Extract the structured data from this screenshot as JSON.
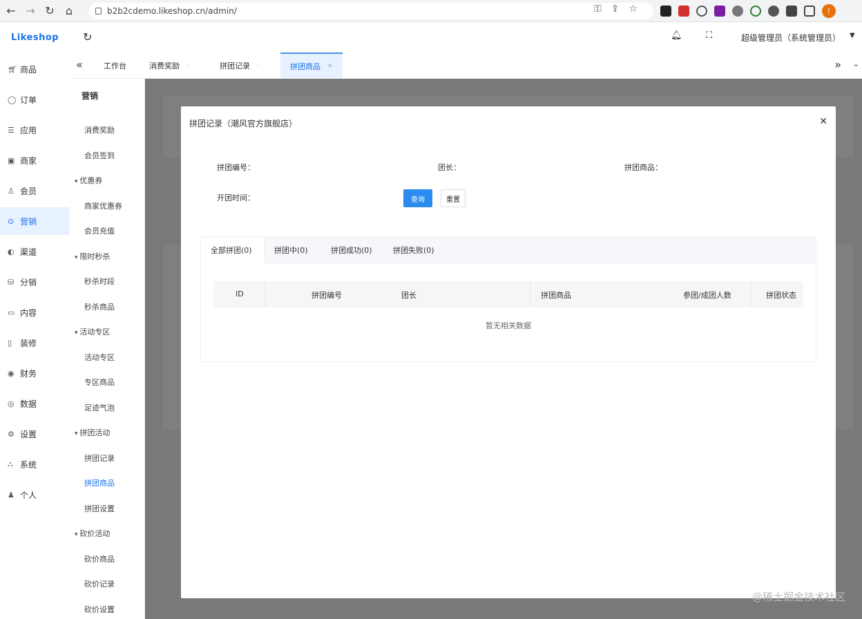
{
  "browser": {
    "url": "b2b2cdemo.likeshop.cn/admin/",
    "profile_initial": "!"
  },
  "header": {
    "logo": "Likeshop",
    "admin_label": "超级管理员（系统管理员）"
  },
  "sidebar1": {
    "items": [
      {
        "icon": "cart-icon",
        "label": "商品"
      },
      {
        "icon": "order-icon",
        "label": "订单"
      },
      {
        "icon": "app-icon",
        "label": "应用"
      },
      {
        "icon": "shop-icon",
        "label": "商家"
      },
      {
        "icon": "member-icon",
        "label": "会员"
      },
      {
        "icon": "marketing-icon",
        "label": "营销",
        "active": true
      },
      {
        "icon": "channel-icon",
        "label": "渠道"
      },
      {
        "icon": "distribution-icon",
        "label": "分销"
      },
      {
        "icon": "content-icon",
        "label": "内容"
      },
      {
        "icon": "decor-icon",
        "label": "装修"
      },
      {
        "icon": "finance-icon",
        "label": "财务"
      },
      {
        "icon": "data-icon",
        "label": "数据"
      },
      {
        "icon": "settings-icon",
        "label": "设置"
      },
      {
        "icon": "system-icon",
        "label": "系统"
      },
      {
        "icon": "person-icon",
        "label": "个人"
      }
    ]
  },
  "sidebar2": {
    "title": "营销",
    "items": [
      {
        "label": "消费奖励",
        "type": "item"
      },
      {
        "label": "会员签到",
        "type": "item"
      },
      {
        "label": "优惠券",
        "type": "group"
      },
      {
        "label": "商家优惠券",
        "type": "item"
      },
      {
        "label": "会员充值",
        "type": "item"
      },
      {
        "label": "限时秒杀",
        "type": "group"
      },
      {
        "label": "秒杀时段",
        "type": "item"
      },
      {
        "label": "秒杀商品",
        "type": "item"
      },
      {
        "label": "活动专区",
        "type": "group"
      },
      {
        "label": "活动专区",
        "type": "item"
      },
      {
        "label": "专区商品",
        "type": "item"
      },
      {
        "label": "足迹气泡",
        "type": "item"
      },
      {
        "label": "拼团活动",
        "type": "group"
      },
      {
        "label": "拼团记录",
        "type": "item"
      },
      {
        "label": "拼团商品",
        "type": "item",
        "active": true
      },
      {
        "label": "拼团设置",
        "type": "item"
      },
      {
        "label": "砍价活动",
        "type": "group"
      },
      {
        "label": "砍价商品",
        "type": "item"
      },
      {
        "label": "砍价记录",
        "type": "item"
      },
      {
        "label": "砍价设置",
        "type": "item"
      }
    ]
  },
  "tabs": [
    {
      "label": "工作台",
      "active": false
    },
    {
      "label": "消费奖励",
      "active": false
    },
    {
      "label": "拼团记录",
      "active": false
    },
    {
      "label": "拼团商品",
      "active": true
    }
  ],
  "modal": {
    "title": "拼团记录（潮风官方旗舰店）",
    "labels": {
      "team_no": "拼团编号：",
      "leader": "团长：",
      "goods": "拼团商品：",
      "time": "开团时间："
    },
    "search_button": "查询",
    "reset_button": "重置",
    "status_tabs": [
      "全部拼团(0)",
      "拼团中(0)",
      "拼团成功(0)",
      "拼团失败(0)"
    ],
    "columns": [
      "ID",
      "拼团编号",
      "团长",
      "拼团商品",
      "参团/成团人数",
      "拼团状态"
    ],
    "empty_text": "暂无相关数据"
  },
  "watermark": "@稀土掘金技术社区"
}
